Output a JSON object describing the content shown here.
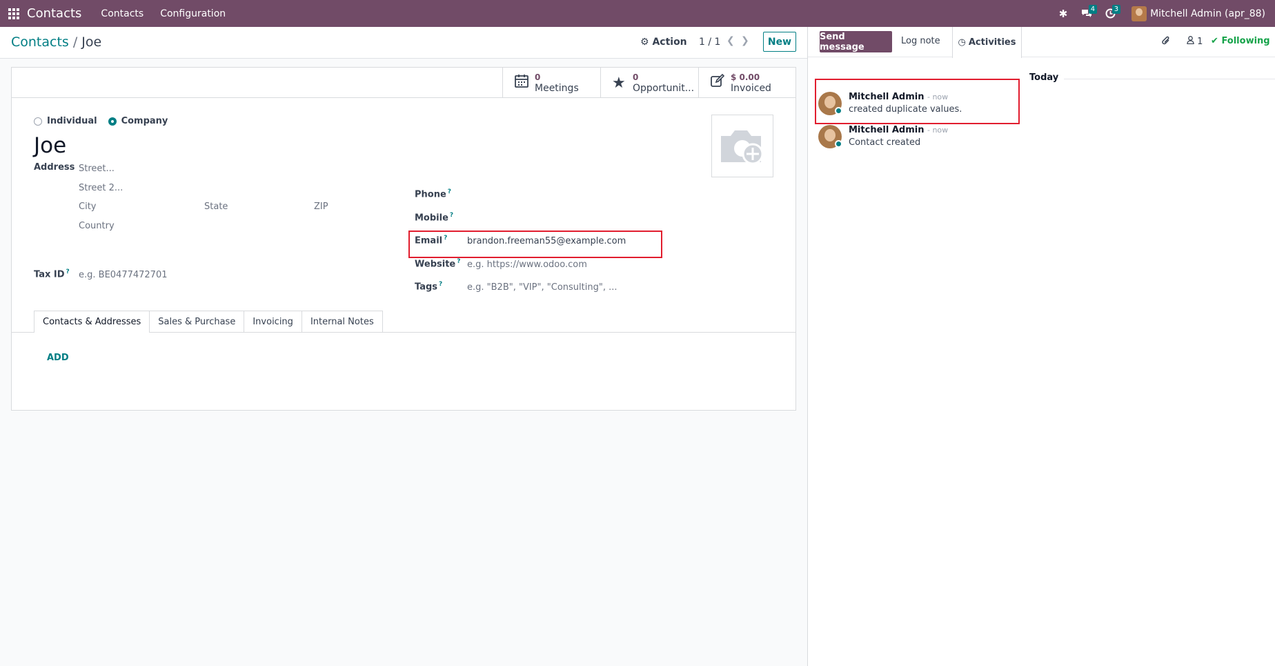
{
  "navbar": {
    "app_name": "Contacts",
    "menus": [
      "Contacts",
      "Configuration"
    ],
    "messages_badge": "4",
    "activities_badge": "3",
    "user": "Mitchell Admin (apr_88)"
  },
  "control": {
    "breadcrumb_parent": "Contacts",
    "breadcrumb_sep": "/",
    "breadcrumb_current": "Joe",
    "action_label": "Action",
    "pager": "1 / 1",
    "new_label": "New"
  },
  "stats": {
    "meetings_value": "0",
    "meetings_label": "Meetings",
    "opportunities_value": "0",
    "opportunities_label": "Opportunit...",
    "invoiced_value": "$ 0.00",
    "invoiced_label": "Invoiced"
  },
  "form": {
    "type_individual": "Individual",
    "type_company": "Company",
    "selected_type": "Company",
    "name": "Joe",
    "address_label": "Address",
    "street_placeholder": "Street...",
    "street2_placeholder": "Street 2...",
    "city_placeholder": "City",
    "state_placeholder": "State",
    "zip_placeholder": "ZIP",
    "country_placeholder": "Country",
    "taxid_label": "Tax ID",
    "taxid_placeholder": "e.g. BE0477472701",
    "phone_label": "Phone",
    "mobile_label": "Mobile",
    "email_label": "Email",
    "email_value": "brandon.freeman55@example.com",
    "website_label": "Website",
    "website_placeholder": "e.g. https://www.odoo.com",
    "tags_label": "Tags",
    "tags_placeholder": "e.g. \"B2B\", \"VIP\", \"Consulting\", ...",
    "help_mark": "?"
  },
  "tabs": [
    "Contacts & Addresses",
    "Sales & Purchase",
    "Invoicing",
    "Internal Notes"
  ],
  "active_tab": "Contacts & Addresses",
  "add_label": "ADD",
  "chatter": {
    "send_message": "Send message",
    "log_note": "Log note",
    "activities": "Activities",
    "followers_count": "1",
    "following": "Following",
    "date_separator": "Today",
    "messages": [
      {
        "author": "Mitchell Admin",
        "time": "- now",
        "body": "created duplicate values."
      },
      {
        "author": "Mitchell Admin",
        "time": "- now",
        "body": "Contact created"
      }
    ]
  },
  "colors": {
    "brand": "#714b67",
    "accent": "#017e84",
    "highlight": "#e11d2e",
    "following": "#16a34a"
  }
}
